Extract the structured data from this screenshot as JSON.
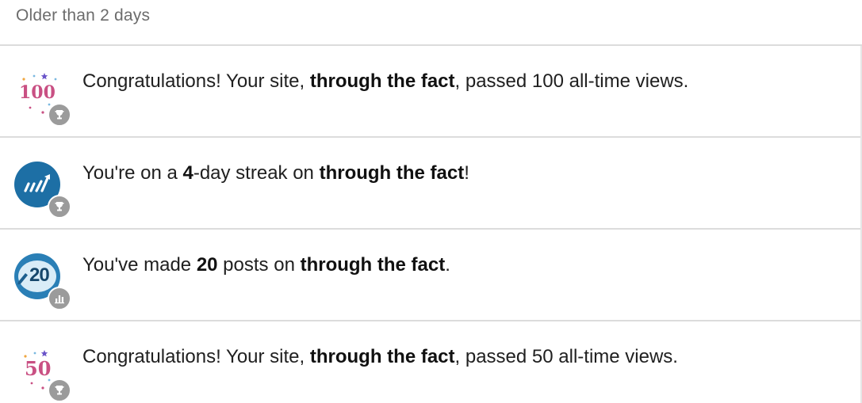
{
  "section": {
    "title": "Older than 2 days"
  },
  "notifications": [
    {
      "icon": "milestone-100-icon",
      "number": "100",
      "parts": {
        "prefix": "Congratulations! Your site, ",
        "site": "through the fact",
        "suffix": ", passed 100 all-time views."
      },
      "badge": "trophy-icon"
    },
    {
      "icon": "streak-icon",
      "parts": {
        "prefix": "You're on a ",
        "count": "4",
        "middle": "-day streak on ",
        "site": "through the fact",
        "suffix": "!"
      },
      "badge": "trophy-icon"
    },
    {
      "icon": "posts-20-icon",
      "number": "20",
      "parts": {
        "prefix": "You've made ",
        "count": "20",
        "middle": " posts on ",
        "site": "through the fact",
        "suffix": "."
      },
      "badge": "stats-icon"
    },
    {
      "icon": "milestone-50-icon",
      "number": "50",
      "parts": {
        "prefix": "Congratulations! Your site, ",
        "site": "through the fact",
        "suffix": ", passed 50 all-time views."
      },
      "badge": "trophy-icon"
    }
  ],
  "colors": {
    "divider": "#dcdcdc",
    "header_text": "#6c6c6c",
    "milestone_pink": "#c95083",
    "streak_blue": "#1d6fa5",
    "posts_blue": "#2a7fb6",
    "badge_gray": "#9b9b9b"
  }
}
